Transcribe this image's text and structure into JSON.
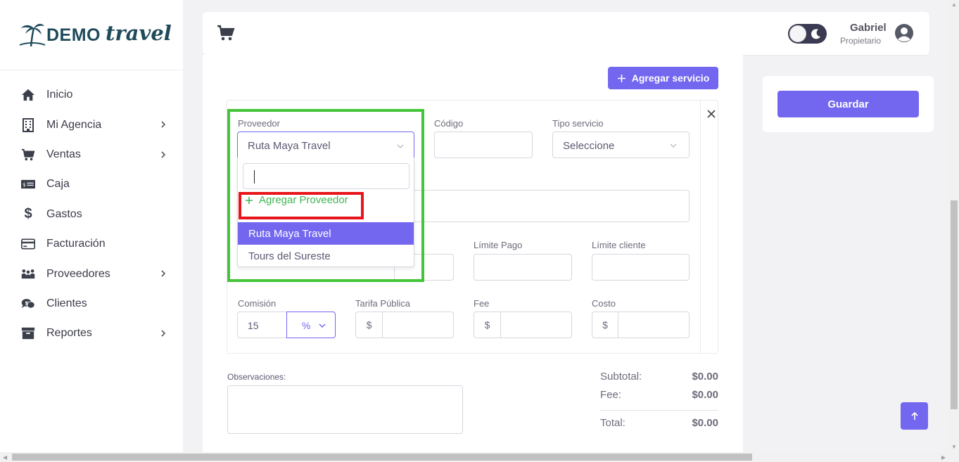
{
  "brand": {
    "demo": "DEMO",
    "travel": "travel"
  },
  "sidebar": {
    "items": [
      {
        "label": "Inicio",
        "icon": "home-icon"
      },
      {
        "label": "Mi Agencia",
        "icon": "building-icon",
        "chevron": true
      },
      {
        "label": "Ventas",
        "icon": "cart-icon",
        "chevron": true
      },
      {
        "label": "Caja",
        "icon": "cash-icon"
      },
      {
        "label": "Gastos",
        "icon": "dollar-icon"
      },
      {
        "label": "Facturación",
        "icon": "credit-card-icon"
      },
      {
        "label": "Proveedores",
        "icon": "people-icon",
        "chevron": true
      },
      {
        "label": "Clientes",
        "icon": "chat-money-icon"
      },
      {
        "label": "Reportes",
        "icon": "archive-icon",
        "chevron": true
      }
    ]
  },
  "header": {
    "user_name": "Gabriel",
    "user_role": "Propietario"
  },
  "toolbar": {
    "add_service_label": "Agregar servicio"
  },
  "form": {
    "proveedor_label": "Proveedor",
    "proveedor_value": "Ruta Maya Travel",
    "codigo_label": "Código",
    "codigo_value": "",
    "tipo_servicio_label": "Tipo servicio",
    "tipo_servicio_value": "Seleccione",
    "limite_pago_label": "Límite Pago",
    "limite_cliente_label": "Límite cliente",
    "comision_label": "Comisión",
    "comision_value": "15",
    "comision_unit": "%",
    "tarifa_label": "Tarifa Pública",
    "fee_label": "Fee",
    "costo_label": "Costo",
    "currency": "$",
    "observaciones_label": "Observaciones:"
  },
  "dropdown": {
    "search_value": "",
    "add_label": "Agregar Proveedor",
    "options": [
      "Ruta Maya Travel",
      "Tours del Sureste"
    ],
    "selected": "Ruta Maya Travel"
  },
  "totals": {
    "subtotal_label": "Subtotal:",
    "subtotal_value": "$0.00",
    "fee_label": "Fee:",
    "fee_value": "$0.00",
    "total_label": "Total:",
    "total_value": "$0.00"
  },
  "actions": {
    "save_label": "Guardar"
  },
  "colors": {
    "accent": "#7367f0",
    "highlight_green": "#44c437",
    "highlight_red": "#e8141b",
    "add_green": "#3fb653"
  }
}
